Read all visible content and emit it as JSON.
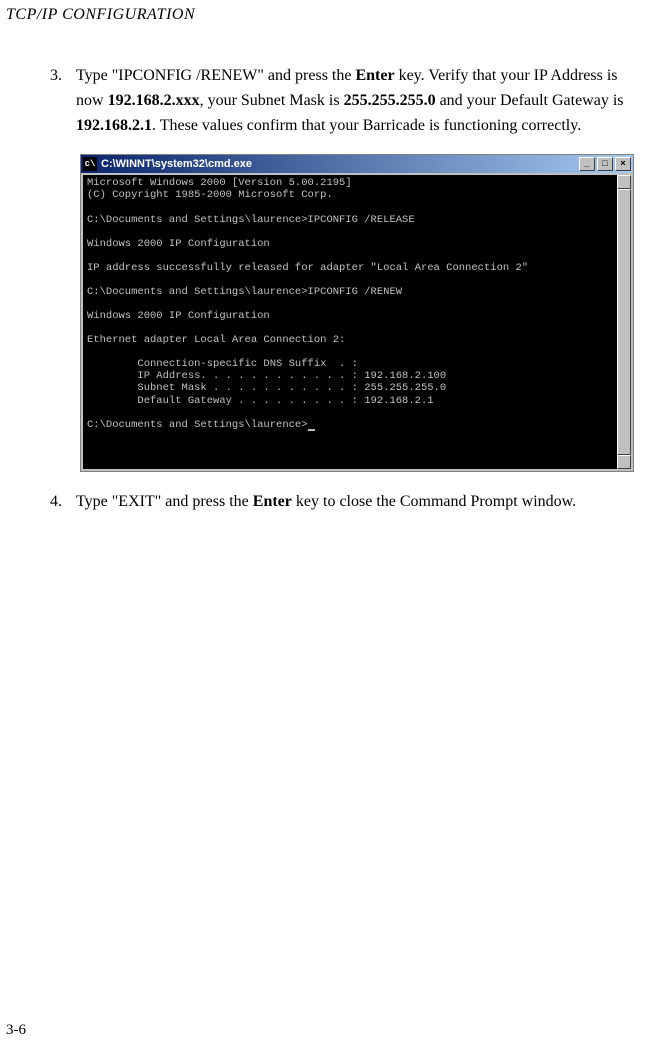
{
  "header": "TCP/IP CONFIGURATION",
  "step3": {
    "num": "3.",
    "pre1": "Type \"IPCONFIG /RENEW\" and press the ",
    "b1": "Enter",
    "mid1": " key. Verify that your IP Address is now ",
    "b2": "192.168.2.xxx",
    "mid2": ", your Subnet Mask is ",
    "b3": "255.255.255.0",
    "mid3": " and your Default Gateway is ",
    "b4": "192.168.2.1",
    "post": ". These values confirm that your Barricade is functioning correctly."
  },
  "cmd": {
    "title": "C:\\WINNT\\system32\\cmd.exe",
    "min": "_",
    "max": "□",
    "close": "×",
    "lines": [
      "Microsoft Windows 2000 [Version 5.00.2195]",
      "(C) Copyright 1985-2000 Microsoft Corp.",
      "",
      "C:\\Documents and Settings\\laurence>IPCONFIG /RELEASE",
      "",
      "Windows 2000 IP Configuration",
      "",
      "IP address successfully released for adapter \"Local Area Connection 2\"",
      "",
      "C:\\Documents and Settings\\laurence>IPCONFIG /RENEW",
      "",
      "Windows 2000 IP Configuration",
      "",
      "Ethernet adapter Local Area Connection 2:",
      "",
      "        Connection-specific DNS Suffix  . :",
      "        IP Address. . . . . . . . . . . . : 192.168.2.100",
      "        Subnet Mask . . . . . . . . . . . : 255.255.255.0",
      "        Default Gateway . . . . . . . . . : 192.168.2.1",
      "",
      "C:\\Documents and Settings\\laurence>"
    ]
  },
  "step4": {
    "num": "4.",
    "pre1": "Type \"EXIT\" and press the ",
    "b1": "Enter",
    "post": " key to close the Command Prompt window."
  },
  "footer": "3-6"
}
